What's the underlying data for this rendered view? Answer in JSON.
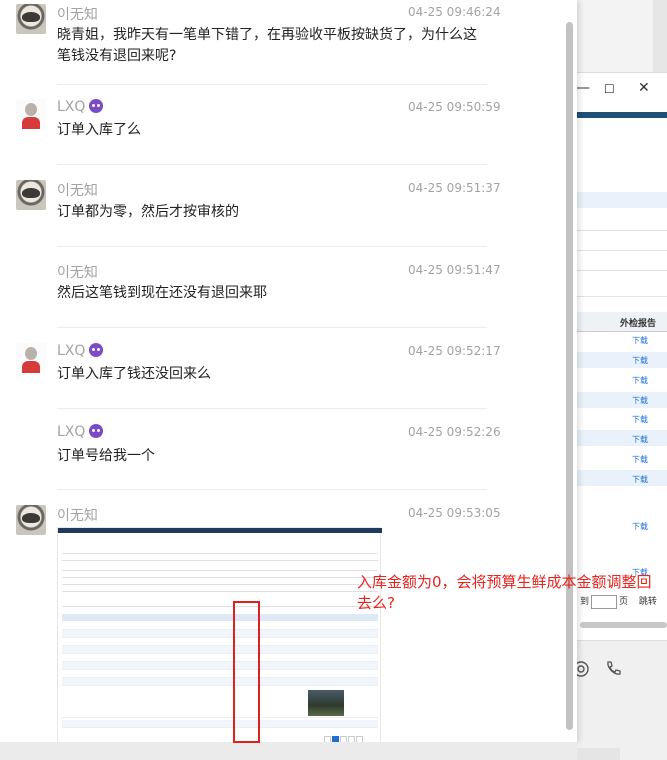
{
  "messages": [
    {
      "sender": "이无知",
      "time": "04-25 09:46:24",
      "text": "晓青姐，我昨天有一笔单下错了，在再验收平板按缺货了，为什么这笔钱没有退回来呢?"
    },
    {
      "sender": "LXQ",
      "time": "04-25 09:50:59",
      "text": "订单入库了么"
    },
    {
      "sender": "이无知",
      "time": "04-25 09:51:37",
      "text": "订单都为零，然后才按审核的"
    },
    {
      "sender": "이无知",
      "time": "04-25 09:51:47",
      "text": "然后这笔钱到现在还没有退回来耶"
    },
    {
      "sender": "LXQ",
      "time": "04-25 09:52:17",
      "text": "订单入库了钱还没回来么"
    },
    {
      "sender": "LXQ",
      "time": "04-25 09:52:26",
      "text": "订单号给我一个"
    },
    {
      "sender": "이无知",
      "time": "04-25 09:53:05",
      "text": ""
    }
  ],
  "annotation": "入库金额为0，会将预算生鲜成本金额调整回去么?",
  "background_window": {
    "column_header": "外检报告",
    "download_label": "下载",
    "page_prefix": "到",
    "page_suffix": "页",
    "confirm": "跳转"
  },
  "colors": {
    "annotation_red": "#e8241e",
    "link_blue": "#1e6fd0",
    "name_gray": "#a3a3a3",
    "lxq_icon_purple": "#7b4bc7"
  }
}
